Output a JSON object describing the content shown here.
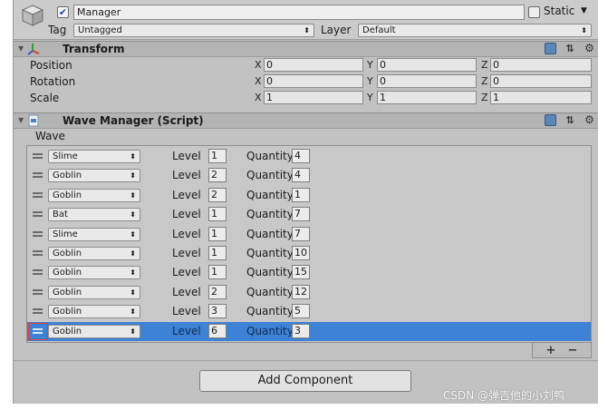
{
  "header": {
    "object_name": "Manager",
    "active_checked": true,
    "static_label": "Static",
    "tag_label": "Tag",
    "tag_value": "Untagged",
    "layer_label": "Layer",
    "layer_value": "Default"
  },
  "transform": {
    "title": "Transform",
    "rows": [
      {
        "label": "Position",
        "x": "0",
        "y": "0",
        "z": "0"
      },
      {
        "label": "Rotation",
        "x": "0",
        "y": "0",
        "z": "0"
      },
      {
        "label": "Scale",
        "x": "1",
        "y": "1",
        "z": "1"
      }
    ],
    "axis_labels": [
      "X",
      "Y",
      "Z"
    ]
  },
  "wave_manager": {
    "title": "Wave Manager (Script)",
    "list_label": "Wave",
    "level_label": "Level",
    "quantity_label": "Quantity",
    "rows": [
      {
        "enemy": "Slime",
        "level": "1",
        "quantity": "4"
      },
      {
        "enemy": "Goblin",
        "level": "2",
        "quantity": "4"
      },
      {
        "enemy": "Goblin",
        "level": "2",
        "quantity": "1"
      },
      {
        "enemy": "Bat",
        "level": "1",
        "quantity": "7"
      },
      {
        "enemy": "Slime",
        "level": "1",
        "quantity": "7"
      },
      {
        "enemy": "Goblin",
        "level": "1",
        "quantity": "10"
      },
      {
        "enemy": "Goblin",
        "level": "1",
        "quantity": "15"
      },
      {
        "enemy": "Goblin",
        "level": "2",
        "quantity": "12"
      },
      {
        "enemy": "Goblin",
        "level": "3",
        "quantity": "5"
      },
      {
        "enemy": "Goblin",
        "level": "6",
        "quantity": "3"
      }
    ],
    "selected_row": 9,
    "add_label": "+",
    "remove_label": "−"
  },
  "add_component_label": "Add Component",
  "watermark": "CSDN @弹吉他的小刘鸭",
  "colors": {
    "selection": "#3d82d4",
    "panel": "#c2c2c2",
    "outline_highlight": "#e43a3a"
  }
}
